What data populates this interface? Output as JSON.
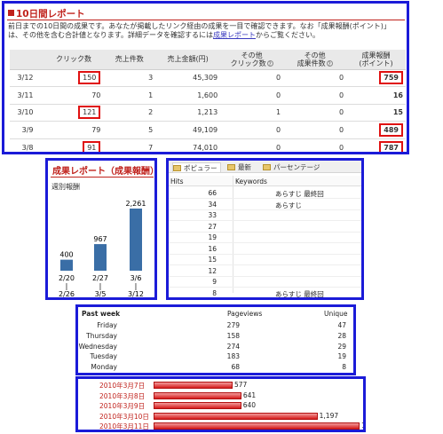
{
  "report": {
    "title": "10日間レポート",
    "desc_pre": "前日までの10日間の成果です。あなたが掲載したリンク経由の成果を一目で確認できます。なお「成果報酬(ポイント)」は、その他を含む合計値となります。詳細データを確認するには",
    "desc_link": "成果レポート",
    "desc_post": "からご覧ください。",
    "headers": [
      "",
      "クリック数",
      "売上件数",
      "売上金額(円)",
      "その他\nクリック数?",
      "その他\n成果件数?",
      "成果報酬\n(ポイント)"
    ],
    "rows": [
      {
        "date": "3/12",
        "clicks": "150",
        "sales": "3",
        "amount": "45,309",
        "oclicks": "0",
        "oresults": "0",
        "reward": "759",
        "hl_click": true,
        "hl_reward": true
      },
      {
        "date": "3/11",
        "clicks": "70",
        "sales": "1",
        "amount": "1,600",
        "oclicks": "0",
        "oresults": "0",
        "reward": "16",
        "hl_click": false,
        "hl_reward": false
      },
      {
        "date": "3/10",
        "clicks": "121",
        "sales": "2",
        "amount": "1,213",
        "oclicks": "1",
        "oresults": "0",
        "reward": "15",
        "hl_click": true,
        "hl_reward": false
      },
      {
        "date": "3/9",
        "clicks": "79",
        "sales": "5",
        "amount": "49,109",
        "oclicks": "0",
        "oresults": "0",
        "reward": "489",
        "hl_click": false,
        "hl_reward": true
      },
      {
        "date": "3/8",
        "clicks": "91",
        "sales": "7",
        "amount": "74,010",
        "oclicks": "0",
        "oresults": "0",
        "reward": "787",
        "hl_click": true,
        "hl_reward": true
      }
    ]
  },
  "weekly": {
    "title": "成果レポート（成果報酬）",
    "subtitle": "週別報酬",
    "chart_data": {
      "type": "bar",
      "categories": [
        [
          "2/20",
          "|",
          "2/26"
        ],
        [
          "2/27",
          "|",
          "3/5"
        ],
        [
          "3/6",
          "|",
          "3/12"
        ]
      ],
      "values": [
        400,
        967,
        2261
      ],
      "value_labels": [
        "400",
        "967",
        "2,261"
      ],
      "ylim": [
        0,
        2261
      ],
      "bar_color": "#3a6ea6"
    }
  },
  "keywords": {
    "tabs": [
      {
        "label": "ポピュラー",
        "active": true
      },
      {
        "label": "最新",
        "active": false
      },
      {
        "label": "パーセンテージ",
        "active": false
      }
    ],
    "col_hits": "Hits",
    "col_keywords": "Keywords",
    "rows": [
      {
        "hits": "66",
        "kw": "あらすじ  最終回"
      },
      {
        "hits": "34",
        "kw": "あらすじ"
      },
      {
        "hits": "33",
        "kw": ""
      },
      {
        "hits": "27",
        "kw": ""
      },
      {
        "hits": "19",
        "kw": ""
      },
      {
        "hits": "16",
        "kw": ""
      },
      {
        "hits": "15",
        "kw": ""
      },
      {
        "hits": "12",
        "kw": ""
      },
      {
        "hits": "9",
        "kw": ""
      },
      {
        "hits": "8",
        "kw": "あらすじ  最終回"
      }
    ]
  },
  "pastweek": {
    "title": "Past week",
    "col_pageviews": "Pageviews",
    "col_unique": "Unique",
    "rows": [
      {
        "day": "Friday",
        "pv": "279",
        "uq": "47"
      },
      {
        "day": "Thursday",
        "pv": "158",
        "uq": "28"
      },
      {
        "day": "Wednesday",
        "pv": "274",
        "uq": "29"
      },
      {
        "day": "Tuesday",
        "pv": "183",
        "uq": "19"
      },
      {
        "day": "Monday",
        "pv": "68",
        "uq": "8"
      }
    ]
  },
  "daily": {
    "chart_data": {
      "type": "bar",
      "categories": [
        "2010年3月7日",
        "2010年3月8日",
        "2010年3月9日",
        "2010年3月10日",
        "2010年3月11日"
      ],
      "values": [
        577,
        641,
        640,
        1197,
        1504
      ],
      "value_labels": [
        "577",
        "641",
        "640",
        "1,197",
        "1,504"
      ],
      "xlim": [
        0,
        1504
      ],
      "bar_color": "#d51b1b"
    }
  }
}
